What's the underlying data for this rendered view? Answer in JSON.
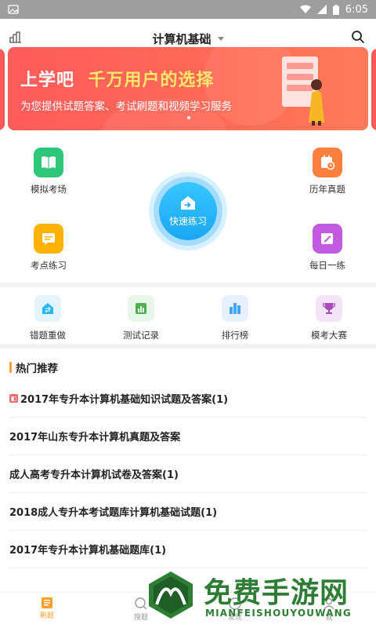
{
  "status_bar": {
    "time": "6:05"
  },
  "header": {
    "title": "计算机基础"
  },
  "banner": {
    "headline_part1": "上学吧",
    "headline_part2": "千万用户的选择",
    "subline": "为您提供试题答案、考试刷题和视频学习服务"
  },
  "main_grid": {
    "mock_exam": "模拟考场",
    "past_papers": "历年真题",
    "quick_practice": "快速练习",
    "topic_practice": "考点练习",
    "daily_practice": "每日一练"
  },
  "tools": [
    {
      "label": "错题重做",
      "icon": "redo-icon",
      "color": "#29b6f6"
    },
    {
      "label": "测试记录",
      "icon": "chart-icon",
      "color": "#4caf50"
    },
    {
      "label": "排行榜",
      "icon": "ranking-icon",
      "color": "#42a5f5"
    },
    {
      "label": "模考大赛",
      "icon": "trophy-icon",
      "color": "#ab47bc"
    }
  ],
  "hot": {
    "title": "热门推荐",
    "items": [
      "2017年专升本计算机基础知识试题及答案(1)",
      "2017年山东专升本计算机真题及答案",
      "成人高考专升本计算机试卷及答案(1)",
      "2018成人专升本考试题库计算机基础试题(1)",
      "2017年专升本计算机基础题库(1)"
    ]
  },
  "tabbar": {
    "tab1": "刷题",
    "tab2": "搜题",
    "tab3": "发现",
    "tab4": "我"
  },
  "watermark": {
    "text": "免费手游网",
    "sub": "MIANFEISHOUYOUWANG"
  },
  "colors": {
    "accent": "#ff9e2c",
    "banner": "#ff5c5c",
    "quick_practice": "#1aa7f5"
  }
}
